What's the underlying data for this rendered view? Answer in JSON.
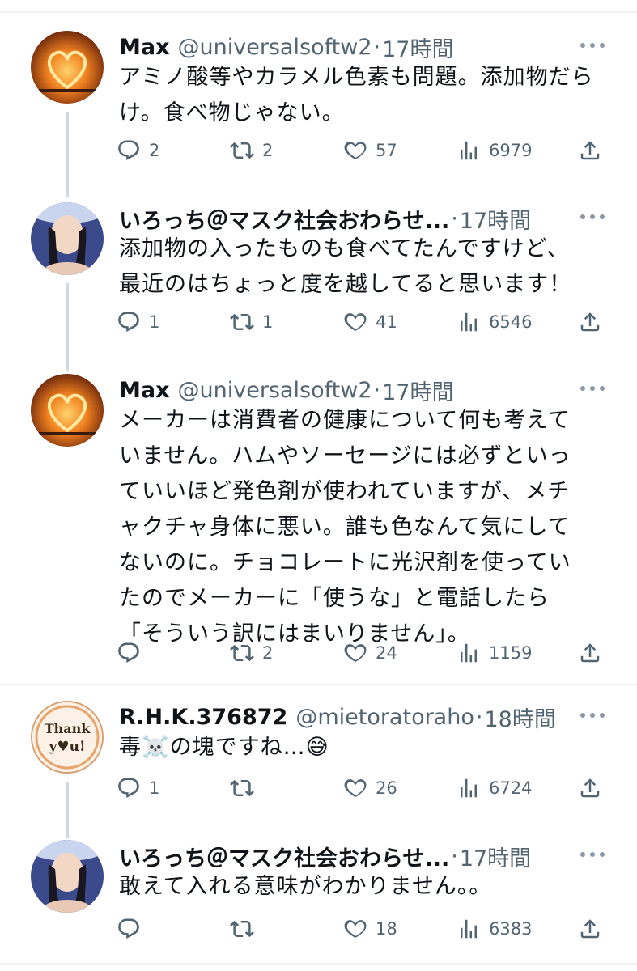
{
  "tweets": [
    {
      "name": "Max",
      "handle": "@universalsoftw2",
      "time": "17時間",
      "lines": [
        "アミノ酸等やカラメル色素も問題。添加物だら",
        "け。食べ物じゃない。"
      ],
      "replies": "2",
      "retweets": "2",
      "likes": "57",
      "views": "6979"
    },
    {
      "name": "いろっち＠マスク社会おわらせ...",
      "handle": "",
      "time": "17時間",
      "lines": [
        "添加物の入ったものも食べてたんですけど、",
        "最近のはちょっと度を越してると思います！"
      ],
      "replies": "1",
      "retweets": "1",
      "likes": "41",
      "views": "6546"
    },
    {
      "name": "Max",
      "handle": "@universalsoftw2",
      "time": "17時間",
      "lines": [
        "メーカーは消費者の健康について何も考えて",
        "いません。ハムやソーセージには必ずといっ",
        "ていいほど発色剤が使われていますが、メチ",
        "ャクチャ身体に悪い。誰も色なんて気にして",
        "ないのに。チョコレートに光沢剤を使ってい",
        "たのでメーカーに「使うな」と電話したら",
        "「そういう訳にはまいりません」。"
      ],
      "replies": "",
      "retweets": "2",
      "likes": "24",
      "views": "1159"
    },
    {
      "name": "R.H.K.376872",
      "handle": "@mietoratoraho",
      "time": "18時間",
      "lines": [
        "毒☠️の塊ですね…😅"
      ],
      "replies": "1",
      "retweets": "",
      "likes": "26",
      "views": "6724"
    },
    {
      "name": "いろっち＠マスク社会おわらせ...",
      "handle": "",
      "time": "17時間",
      "lines": [
        "敢えて入れる意味がわかりません。。"
      ],
      "replies": "",
      "retweets": "",
      "likes": "18",
      "views": "6383"
    }
  ],
  "colors": {
    "text": "#0f1419",
    "secondary": "#536471",
    "divider": "#eff3f4",
    "thread": "#cfd9de"
  },
  "icons": [
    "reply-icon",
    "retweet-icon",
    "like-icon",
    "views-icon",
    "share-icon",
    "more-icon"
  ]
}
